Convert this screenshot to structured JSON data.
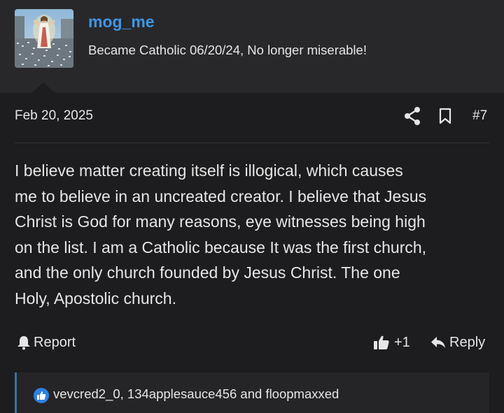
{
  "user": {
    "username": "mog_me",
    "title": "Became Catholic 06/20/24, No longer miserable!"
  },
  "post": {
    "date": "Feb 20, 2025",
    "number": "#7",
    "body_lines": [
      "I believe matter creating itself is illogical, which causes",
      "me to believe in an uncreated creator. I believe that Jesus",
      "Christ is God for many reasons, eye witnesses being high",
      "on the list. I am a Catholic because It was the first church,",
      "and the only church founded by Jesus Christ. The one",
      "Holy, Apostolic church."
    ]
  },
  "actions": {
    "report_label": "Report",
    "like_count": "+1",
    "reply_label": "Reply"
  },
  "reactions": {
    "text": "vevcred2_0, 134applesauce456 and floopmaxxed"
  },
  "icons": {
    "share": "share-icon",
    "bookmark": "bookmark-icon",
    "report": "bell-icon",
    "like": "thumbs-up-icon",
    "reply": "reply-arrow-icon",
    "reaction": "like-badge-icon"
  },
  "colors": {
    "accent": "#3f96e6",
    "background": "#1d1d1f",
    "header_background": "#28282b",
    "reaction_border": "#3f6fa0"
  }
}
